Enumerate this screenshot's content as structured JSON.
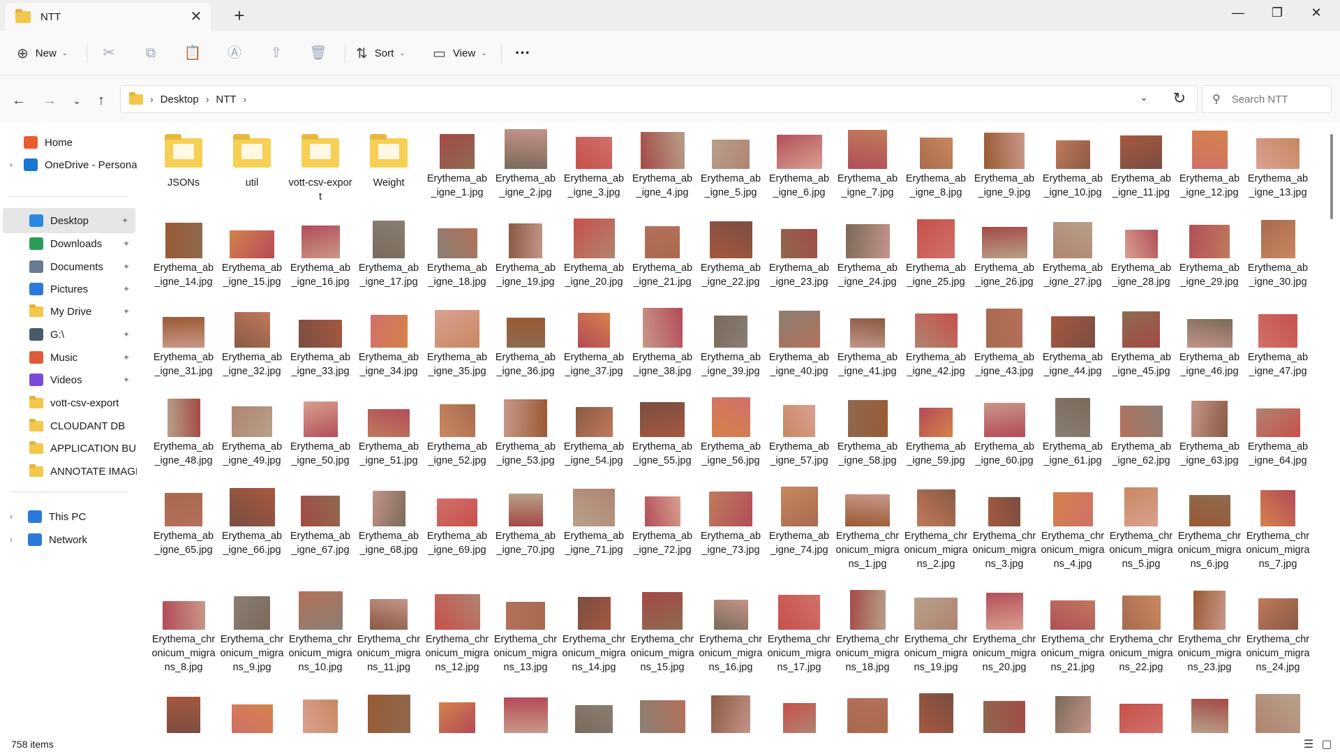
{
  "window": {
    "tab_title": "NTT",
    "tab_close": "✕",
    "new_tab": "+",
    "minimize": "—",
    "restore": "❐",
    "close": "✕"
  },
  "toolbar": {
    "new_label": "New",
    "sort_label": "Sort",
    "view_label": "View",
    "more_label": "···",
    "icons": [
      "cut-icon",
      "copy-icon",
      "paste-icon",
      "rename-icon",
      "share-icon",
      "delete-icon"
    ]
  },
  "address": {
    "crumbs": [
      "Desktop",
      "NTT"
    ],
    "search_placeholder": "Search NTT"
  },
  "sidebar": {
    "items": [
      {
        "label": "Home",
        "icon": "home-icon",
        "color": "#e85c30"
      },
      {
        "label": "OneDrive - Persona",
        "icon": "cloud-icon",
        "color": "#1976d2"
      },
      {
        "label": "Desktop",
        "icon": "desktop-icon",
        "color": "#2a8ae0"
      },
      {
        "label": "Downloads",
        "icon": "download-icon",
        "color": "#2a9d5a"
      },
      {
        "label": "Documents",
        "icon": "document-icon",
        "color": "#6b7b8f"
      },
      {
        "label": "Pictures",
        "icon": "pictures-icon",
        "color": "#2b79d9"
      },
      {
        "label": "My Drive",
        "icon": "folder-icon",
        "color": "#f3c74b"
      },
      {
        "label": "G:\\",
        "icon": "drive-icon",
        "color": "#4a5a6a"
      },
      {
        "label": "Music",
        "icon": "music-icon",
        "color": "#e05a3a"
      },
      {
        "label": "Videos",
        "icon": "videos-icon",
        "color": "#7b4ad8"
      },
      {
        "label": "vott-csv-export",
        "icon": "folder-icon",
        "color": "#f3c74b"
      },
      {
        "label": "CLOUDANT DB",
        "icon": "folder-icon",
        "color": "#f3c74b"
      },
      {
        "label": "APPLICATION BUILD",
        "icon": "folder-icon",
        "color": "#f3c74b"
      },
      {
        "label": "ANNOTATE IMAGES",
        "icon": "folder-icon",
        "color": "#f3c74b"
      },
      {
        "label": "This PC",
        "icon": "computer-icon",
        "color": "#2b79d9"
      },
      {
        "label": "Network",
        "icon": "network-icon",
        "color": "#2b79d9"
      }
    ],
    "pin_glyph": "📌"
  },
  "files": [
    "JSONs",
    "util",
    "vott-csv-export",
    "Weight",
    "Erythema_ab_igne_1.jpg",
    "Erythema_ab_igne_2.jpg",
    "Erythema_ab_igne_3.jpg",
    "Erythema_ab_igne_4.jpg",
    "Erythema_ab_igne_5.jpg",
    "Erythema_ab_igne_6.jpg",
    "Erythema_ab_igne_7.jpg",
    "Erythema_ab_igne_8.jpg",
    "Erythema_ab_igne_9.jpg",
    "Erythema_ab_igne_10.jpg",
    "Erythema_ab_igne_11.jpg",
    "Erythema_ab_igne_12.jpg",
    "Erythema_ab_igne_13.jpg",
    "Erythema_ab_igne_14.jpg",
    "Erythema_ab_igne_15.jpg",
    "Erythema_ab_igne_16.jpg",
    "Erythema_ab_igne_17.jpg",
    "Erythema_ab_igne_18.jpg",
    "Erythema_ab_igne_19.jpg",
    "Erythema_ab_igne_20.jpg",
    "Erythema_ab_igne_21.jpg",
    "Erythema_ab_igne_22.jpg",
    "Erythema_ab_igne_23.jpg",
    "Erythema_ab_igne_24.jpg",
    "Erythema_ab_igne_25.jpg",
    "Erythema_ab_igne_26.jpg",
    "Erythema_ab_igne_27.jpg",
    "Erythema_ab_igne_28.jpg",
    "Erythema_ab_igne_29.jpg",
    "Erythema_ab_igne_30.jpg",
    "Erythema_ab_igne_31.jpg",
    "Erythema_ab_igne_32.jpg",
    "Erythema_ab_igne_33.jpg",
    "Erythema_ab_igne_34.jpg",
    "Erythema_ab_igne_35.jpg",
    "Erythema_ab_igne_36.jpg",
    "Erythema_ab_igne_37.jpg",
    "Erythema_ab_igne_38.jpg",
    "Erythema_ab_igne_39.jpg",
    "Erythema_ab_igne_40.jpg",
    "Erythema_ab_igne_41.jpg",
    "Erythema_ab_igne_42.jpg",
    "Erythema_ab_igne_43.jpg",
    "Erythema_ab_igne_44.jpg",
    "Erythema_ab_igne_45.jpg",
    "Erythema_ab_igne_46.jpg",
    "Erythema_ab_igne_47.jpg",
    "Erythema_ab_igne_48.jpg",
    "Erythema_ab_igne_49.jpg",
    "Erythema_ab_igne_50.jpg",
    "Erythema_ab_igne_51.jpg",
    "Erythema_ab_igne_52.jpg",
    "Erythema_ab_igne_53.jpg",
    "Erythema_ab_igne_54.jpg",
    "Erythema_ab_igne_55.jpg",
    "Erythema_ab_igne_56.jpg",
    "Erythema_ab_igne_57.jpg",
    "Erythema_ab_igne_58.jpg",
    "Erythema_ab_igne_59.jpg",
    "Erythema_ab_igne_60.jpg",
    "Erythema_ab_igne_61.jpg",
    "Erythema_ab_igne_62.jpg",
    "Erythema_ab_igne_63.jpg",
    "Erythema_ab_igne_64.jpg",
    "Erythema_ab_igne_65.jpg",
    "Erythema_ab_igne_66.jpg",
    "Erythema_ab_igne_67.jpg",
    "Erythema_ab_igne_68.jpg",
    "Erythema_ab_igne_69.jpg",
    "Erythema_ab_igne_70.jpg",
    "Erythema_ab_igne_71.jpg",
    "Erythema_ab_igne_72.jpg",
    "Erythema_ab_igne_73.jpg",
    "Erythema_ab_igne_74.jpg",
    "Erythema_chronicum_migrans_1.jpg",
    "Erythema_chronicum_migrans_2.jpg",
    "Erythema_chronicum_migrans_3.jpg",
    "Erythema_chronicum_migrans_4.jpg",
    "Erythema_chronicum_migrans_5.jpg",
    "Erythema_chronicum_migrans_6.jpg",
    "Erythema_chronicum_migrans_7.jpg",
    "Erythema_chronicum_migrans_8.jpg",
    "Erythema_chronicum_migrans_9.jpg",
    "Erythema_chronicum_migrans_10.jpg",
    "Erythema_chronicum_migrans_11.jpg",
    "Erythema_chronicum_migrans_12.jpg",
    "Erythema_chronicum_migrans_13.jpg",
    "Erythema_chronicum_migrans_14.jpg",
    "Erythema_chronicum_migrans_15.jpg",
    "Erythema_chronicum_migrans_16.jpg",
    "Erythema_chronicum_migrans_17.jpg",
    "Erythema_chronicum_migrans_18.jpg",
    "Erythema_chronicum_migrans_19.jpg",
    "Erythema_chronicum_migrans_20.jpg",
    "Erythema_chronicum_migrans_21.jpg",
    "Erythema_chronicum_migrans_22.jpg",
    "Erythema_chronicum_migrans_23.jpg",
    "Erythema_chronicum_migrans_24.jpg",
    "",
    "",
    "",
    "",
    "",
    "",
    "",
    "",
    "",
    "",
    "",
    "",
    "",
    "",
    "",
    "",
    ""
  ],
  "thumb_colors": [
    "#8a5a44",
    "#c8504a",
    "#b5705a",
    "#7a4e42",
    "#a44a45",
    "#c49488",
    "#d0706a",
    "#b7a08a",
    "#b08470",
    "#d9a090",
    "#b24e5a",
    "#a86a4e",
    "#9a5a34",
    "#c07a5a",
    "#a6583e",
    "#d4824a",
    "#c88860",
    "#8e6a50",
    "#b44a58",
    "#c89888",
    "#7a6a5a",
    "#8a7e74"
  ],
  "status": {
    "item_count": "758 items"
  }
}
